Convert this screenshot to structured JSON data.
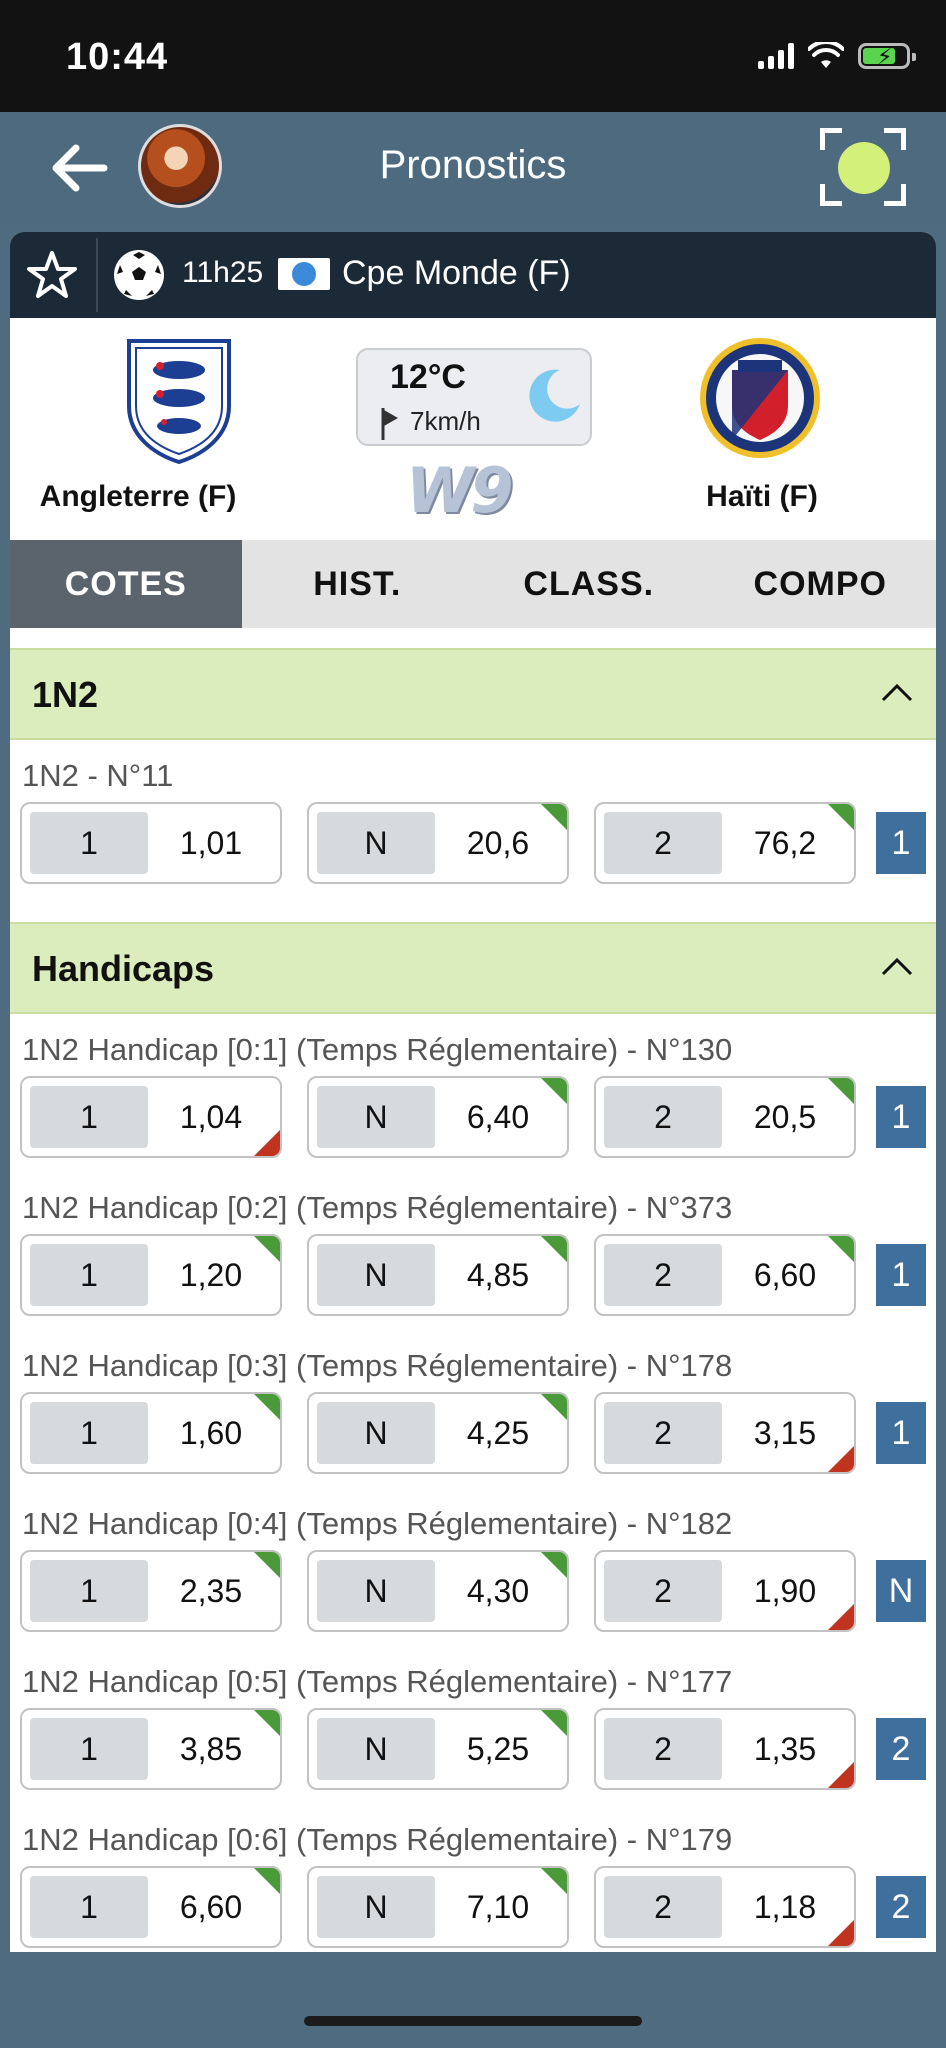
{
  "status_bar": {
    "time": "10:44"
  },
  "header": {
    "title": "Pronostics"
  },
  "match": {
    "time": "11h25",
    "competition": "Cpe Monde (F)",
    "home_team": "Angleterre (F)",
    "away_team": "Haïti (F)",
    "weather": {
      "temperature": "12°C",
      "wind": "7km/h"
    },
    "tv_channel": "W9"
  },
  "tabs": [
    {
      "label": "COTES",
      "active": true
    },
    {
      "label": "HIST.",
      "active": false
    },
    {
      "label": "CLASS.",
      "active": false
    },
    {
      "label": "COMPO",
      "active": false
    }
  ],
  "sections": [
    {
      "title": "1N2",
      "bets": [
        {
          "label": "1N2 - N°11",
          "odds": [
            {
              "key": "1",
              "value": "1,01",
              "trend": ""
            },
            {
              "key": "N",
              "value": "20,6",
              "trend": "up"
            },
            {
              "key": "2",
              "value": "76,2",
              "trend": "up"
            }
          ],
          "result": "1"
        }
      ]
    },
    {
      "title": "Handicaps",
      "bets": [
        {
          "label": "1N2 Handicap [0:1] (Temps Réglementaire) - N°130",
          "odds": [
            {
              "key": "1",
              "value": "1,04",
              "trend": "down"
            },
            {
              "key": "N",
              "value": "6,40",
              "trend": "up"
            },
            {
              "key": "2",
              "value": "20,5",
              "trend": "up"
            }
          ],
          "result": "1"
        },
        {
          "label": "1N2 Handicap [0:2] (Temps Réglementaire) - N°373",
          "odds": [
            {
              "key": "1",
              "value": "1,20",
              "trend": "up"
            },
            {
              "key": "N",
              "value": "4,85",
              "trend": "up"
            },
            {
              "key": "2",
              "value": "6,60",
              "trend": "up"
            }
          ],
          "result": "1"
        },
        {
          "label": "1N2 Handicap [0:3] (Temps Réglementaire) - N°178",
          "odds": [
            {
              "key": "1",
              "value": "1,60",
              "trend": "up"
            },
            {
              "key": "N",
              "value": "4,25",
              "trend": "up"
            },
            {
              "key": "2",
              "value": "3,15",
              "trend": "down"
            }
          ],
          "result": "1"
        },
        {
          "label": "1N2 Handicap [0:4] (Temps Réglementaire) - N°182",
          "odds": [
            {
              "key": "1",
              "value": "2,35",
              "trend": "up"
            },
            {
              "key": "N",
              "value": "4,30",
              "trend": "up"
            },
            {
              "key": "2",
              "value": "1,90",
              "trend": "down"
            }
          ],
          "result": "N"
        },
        {
          "label": "1N2 Handicap [0:5] (Temps Réglementaire) - N°177",
          "odds": [
            {
              "key": "1",
              "value": "3,85",
              "trend": "up"
            },
            {
              "key": "N",
              "value": "5,25",
              "trend": "up"
            },
            {
              "key": "2",
              "value": "1,35",
              "trend": "down"
            }
          ],
          "result": "2"
        },
        {
          "label": "1N2 Handicap [0:6] (Temps Réglementaire) - N°179",
          "odds": [
            {
              "key": "1",
              "value": "6,60",
              "trend": "up"
            },
            {
              "key": "N",
              "value": "7,10",
              "trend": "up"
            },
            {
              "key": "2",
              "value": "1,18",
              "trend": "down"
            }
          ],
          "result": "2"
        }
      ]
    }
  ],
  "colors": {
    "trend_up": "#4a9a3a",
    "trend_down": "#c0331f",
    "section_bg": "#dbedbc",
    "badge": "#3f6f9d"
  }
}
